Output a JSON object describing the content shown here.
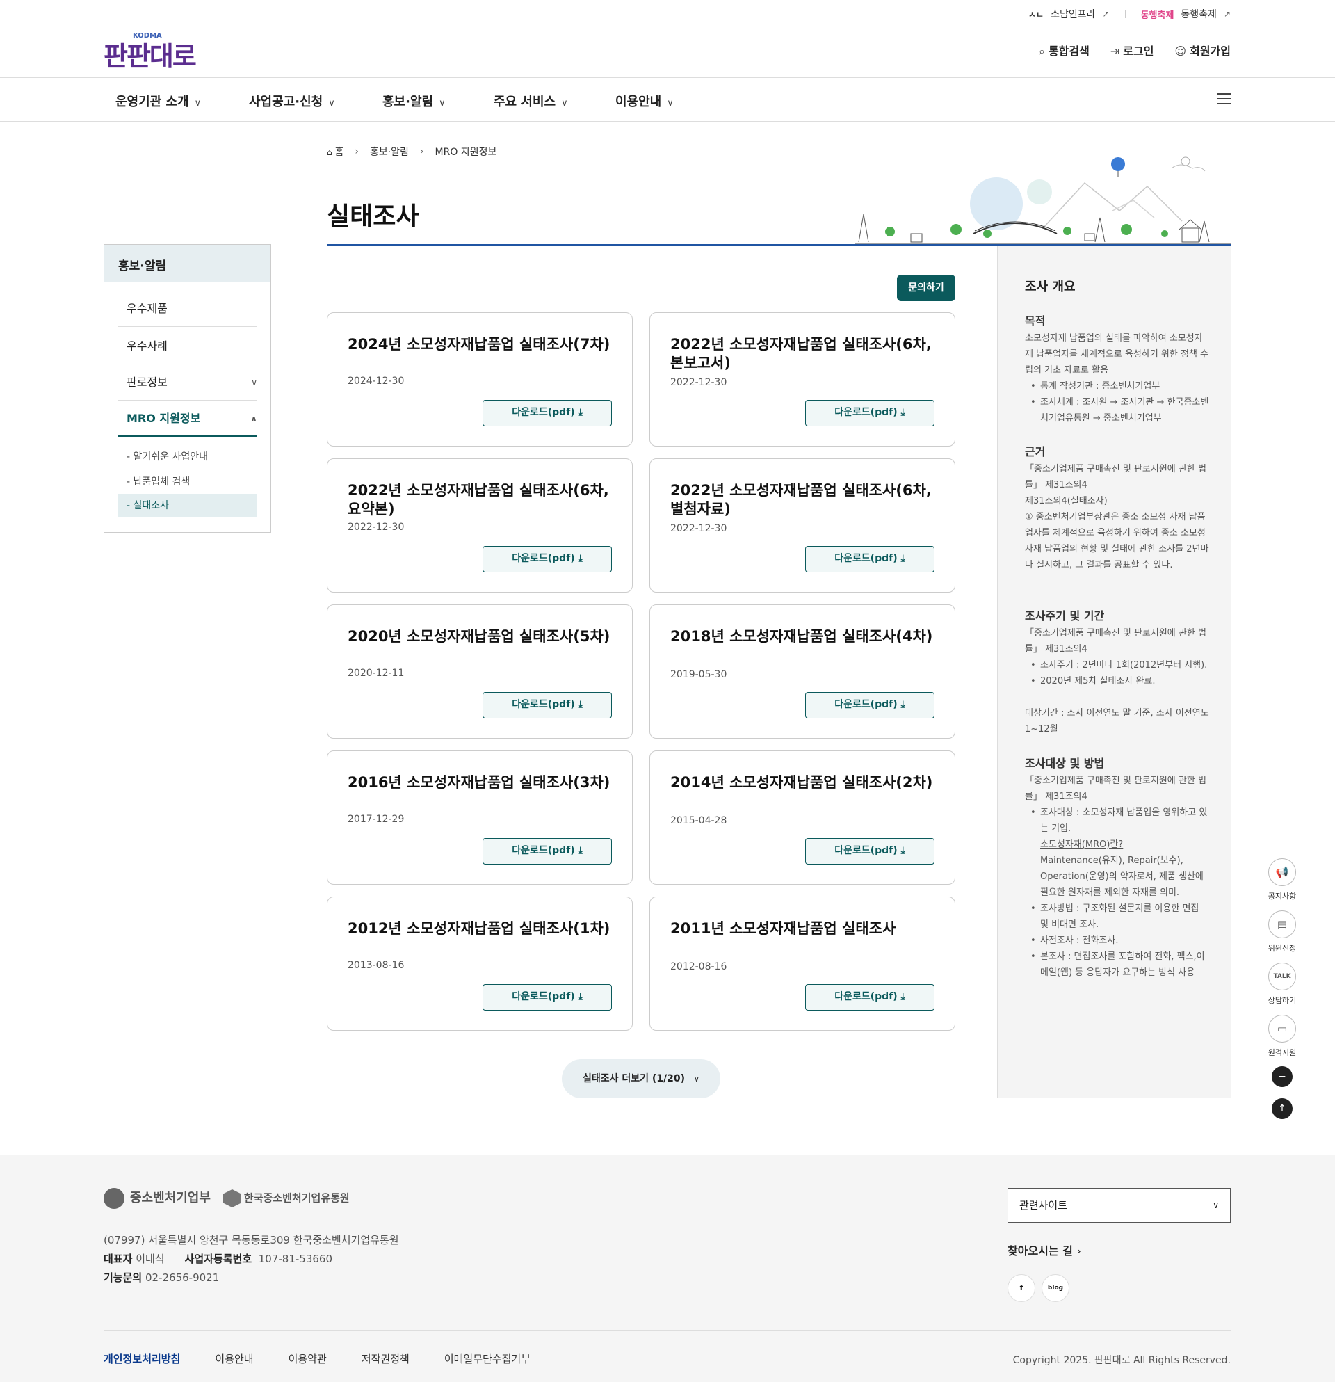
{
  "header": {
    "top_links": [
      {
        "label": "소담인프라"
      },
      {
        "label": "동행축제"
      }
    ],
    "logo": {
      "text": "판판대로",
      "sub": "KODMA"
    },
    "util": [
      {
        "label": "통합검색"
      },
      {
        "label": "로그인"
      },
      {
        "label": "회원가입"
      }
    ]
  },
  "gnb": [
    {
      "label": "운영기관 소개"
    },
    {
      "label": "사업공고·신청"
    },
    {
      "label": "홍보·알림"
    },
    {
      "label": "주요 서비스"
    },
    {
      "label": "이용안내"
    }
  ],
  "breadcrumb": [
    "홈",
    "홍보·알림",
    "MRO 지원정보"
  ],
  "page_title": "실태조사",
  "lnb": {
    "title": "홍보·알림",
    "items": [
      {
        "label": "우수제품"
      },
      {
        "label": "우수사례"
      },
      {
        "label": "판로정보"
      },
      {
        "label": "MRO 지원정보"
      }
    ],
    "sub_items": [
      {
        "label": "- 알기쉬운 사업안내"
      },
      {
        "label": "- 납품업체 검색"
      },
      {
        "label": "- 실태조사"
      }
    ]
  },
  "ask_button": "문의하기",
  "cards": [
    {
      "title": "2024년 소모성자재납품업 실태조사(7차)",
      "date": "2024-12-30",
      "download": "다운로드(pdf)"
    },
    {
      "title": "2022년 소모성자재납품업 실태조사(6차, 본보고서)",
      "date": "2022-12-30",
      "download": "다운로드(pdf)"
    },
    {
      "title": "2022년 소모성자재납품업 실태조사(6차, 요약본)",
      "date": "2022-12-30",
      "download": "다운로드(pdf)"
    },
    {
      "title": "2022년 소모성자재납품업 실태조사(6차, 별첨자료)",
      "date": "2022-12-30",
      "download": "다운로드(pdf)"
    },
    {
      "title": "2020년 소모성자재납품업 실태조사(5차)",
      "date": "2020-12-11",
      "download": "다운로드(pdf)"
    },
    {
      "title": "2018년 소모성자재납품업 실태조사(4차)",
      "date": "2019-05-30",
      "download": "다운로드(pdf)"
    },
    {
      "title": "2016년 소모성자재납품업 실태조사(3차)",
      "date": "2017-12-29",
      "download": "다운로드(pdf)"
    },
    {
      "title": "2014년 소모성자재납품업 실태조사(2차)",
      "date": "2015-04-28",
      "download": "다운로드(pdf)"
    },
    {
      "title": "2012년 소모성자재납품업 실태조사(1차)",
      "date": "2013-08-16",
      "download": "다운로드(pdf)"
    },
    {
      "title": "2011년 소모성자재납품업 실태조사",
      "date": "2012-08-16",
      "download": "다운로드(pdf)"
    }
  ],
  "more_button": "실태조사 더보기 (1/20)",
  "side": {
    "title": "조사 개요",
    "purpose_h": "목적",
    "purpose_p": "소모성자재 납품업의 실태를 파악하여 소모성자재 납품업자를 체계적으로 육성하기 위한 정책 수립의 기초 자료로 활용",
    "purpose_li1": "통계 작성기관 : 중소벤처기업부",
    "purpose_li2": "조사체계 : 조사원 → 조사기관 → 한국중소벤처기업유통원 → 중소벤처기업부",
    "basis_h": "근거",
    "basis_p1": "「중소기업제품 구매촉진 및 판로지원에 관한 법률」 제31조의4",
    "basis_p2": "제31조의4(실태조사)",
    "basis_p3": "① 중소벤처기업부장관은 중소 소모성 자재 납품업자를 체계적으로 육성하기 위하여 중소 소모성 자재 납품업의 현황 및 실태에 관한 조사를 2년마다 실시하고, 그 결과를 공표할 수 있다.",
    "cycle_h": "조사주기 및 기간",
    "cycle_p": "「중소기업제품 구매촉진 및 판로지원에 관한 법률」 제31조의4",
    "cycle_li1": "조사주기 : 2년마다 1회(2012년부터 시행).",
    "cycle_li2": "2020년 제5차 실태조사 완료.",
    "cycle_p2": "대상기간 : 조사 이전연도 말 기준, 조사 이전연도 1~12월",
    "target_h": "조사대상 및 방법",
    "target_p": "「중소기업제품 구매촉진 및 판로지원에 관한 법률」 제31조의4",
    "target_li1": "조사대상 : 소모성자재 납품업을 영위하고 있는 기업.",
    "target_mro_link": "소모성자재(MRO)란?",
    "target_mro_desc": "Maintenance(유지), Repair(보수), Operation(운영)의 약자로서, 제품 생산에 필요한 원자재를 제외한 자재를 의미.",
    "target_li2": "조사방법 : 구조화된 설문지를 이용한 면접 및 비대면 조사.",
    "target_li3": "사전조사 : 전화조사.",
    "target_li4": "본조사 : 면접조사를 포함하여 전화, 팩스,이메일(웹) 등 응답자가 요구하는 방식 사용"
  },
  "quick_menu": [
    {
      "label": "공지사항",
      "icon": "megaphone-icon"
    },
    {
      "label": "위원신청",
      "icon": "clipboard-icon"
    },
    {
      "label": "상담하기",
      "icon": "talk-icon"
    },
    {
      "label": "원격지원",
      "icon": "monitor-icon"
    }
  ],
  "footer": {
    "logo1": "중소벤처기업부",
    "logo2": "한국중소벤처기업유통원",
    "address": "(07997) 서울특별시 양천구 목동동로309 한국중소벤처기업유통원",
    "ceo_label": "대표자",
    "ceo": "이태식",
    "biz_label": "사업자등록번호",
    "biz": "107-81-53660",
    "tel_label": "기능문의",
    "tel": "02-2656-9021",
    "related": "관련사이트",
    "directions": "찾아오시는 길",
    "links": [
      "개인정보처리방침",
      "이용안내",
      "이용약관",
      "저작권정책",
      "이메일무단수집거부"
    ],
    "copyright": "Copyright 2025. 판판대로 All Rights Reserved."
  }
}
